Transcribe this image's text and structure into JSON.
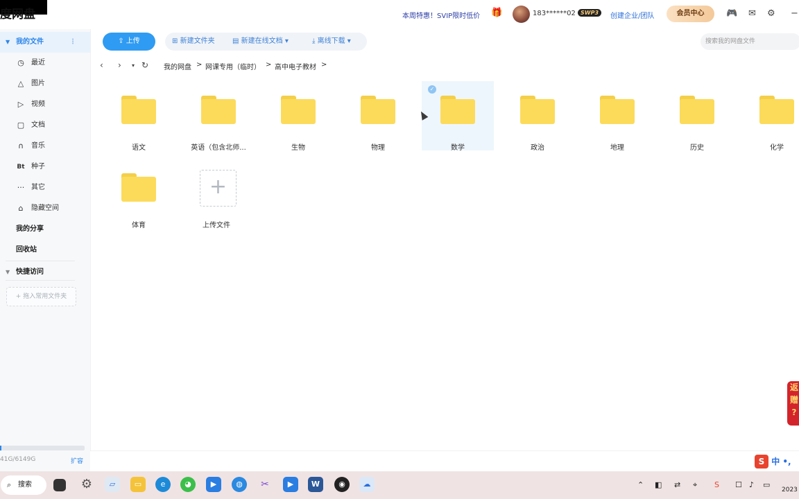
{
  "app": {
    "title": "度网盘",
    "promo": "本周特惠！SVIP限时低价",
    "user": "183******02",
    "svip": "SWP3",
    "enterprise": "创建企业/团队",
    "vip_center": "会员中心"
  },
  "sidebar": {
    "my_files": "我的文件",
    "items": [
      {
        "icon": "clock-icon",
        "glyph": "◷",
        "label": "最近"
      },
      {
        "icon": "image-icon",
        "glyph": "△",
        "label": "图片"
      },
      {
        "icon": "video-icon",
        "glyph": "▷",
        "label": "视频"
      },
      {
        "icon": "document-icon",
        "glyph": "▢",
        "label": "文档"
      },
      {
        "icon": "headphones-icon",
        "glyph": "∩",
        "label": "音乐"
      },
      {
        "icon": "bt-icon",
        "glyph": "Bt",
        "label": "种子"
      },
      {
        "icon": "more-icon",
        "glyph": "···",
        "label": "其它"
      },
      {
        "icon": "lock-icon",
        "glyph": "⌂",
        "label": "隐藏空间"
      }
    ],
    "my_share": "我的分享",
    "recycle": "回收站",
    "quick_access": "快捷访问",
    "pin_folder": "+ 拖入常用文件夹",
    "storage": "41G/6149G",
    "storage_used_fraction": 0.0067,
    "expand": "扩容"
  },
  "toolbar": {
    "upload": "上传",
    "new_folder": "新建文件夹",
    "new_online_doc": "新建在线文档",
    "offline_download": "离线下载",
    "search_placeholder": "搜索我的网盘文件"
  },
  "breadcrumb": {
    "items": [
      "我的网盘",
      "网课专用（临时）",
      "高中电子教材"
    ],
    "separator": ">"
  },
  "folders": [
    {
      "name": "语文",
      "selected": false
    },
    {
      "name": "英语（包含北师...",
      "selected": false
    },
    {
      "name": "生物",
      "selected": false
    },
    {
      "name": "物理",
      "selected": false
    },
    {
      "name": "数学",
      "selected": true
    },
    {
      "name": "政治",
      "selected": false
    },
    {
      "name": "地理",
      "selected": false
    },
    {
      "name": "历史",
      "selected": false
    },
    {
      "name": "化学",
      "selected": false
    },
    {
      "name": "体育",
      "selected": false
    }
  ],
  "upload_tile": "上传文件",
  "float_ad": [
    "返",
    "赠",
    "?"
  ],
  "ime": {
    "brand": "S",
    "lang": "中",
    "punct": "•,"
  },
  "taskbar": {
    "search": "搜索",
    "clock": "2023"
  },
  "colors": {
    "accent": "#2f9bf2",
    "folder": "#fcdb5b",
    "selected_bg": "#eef6fd",
    "taskbar": "#f0e3e3"
  }
}
